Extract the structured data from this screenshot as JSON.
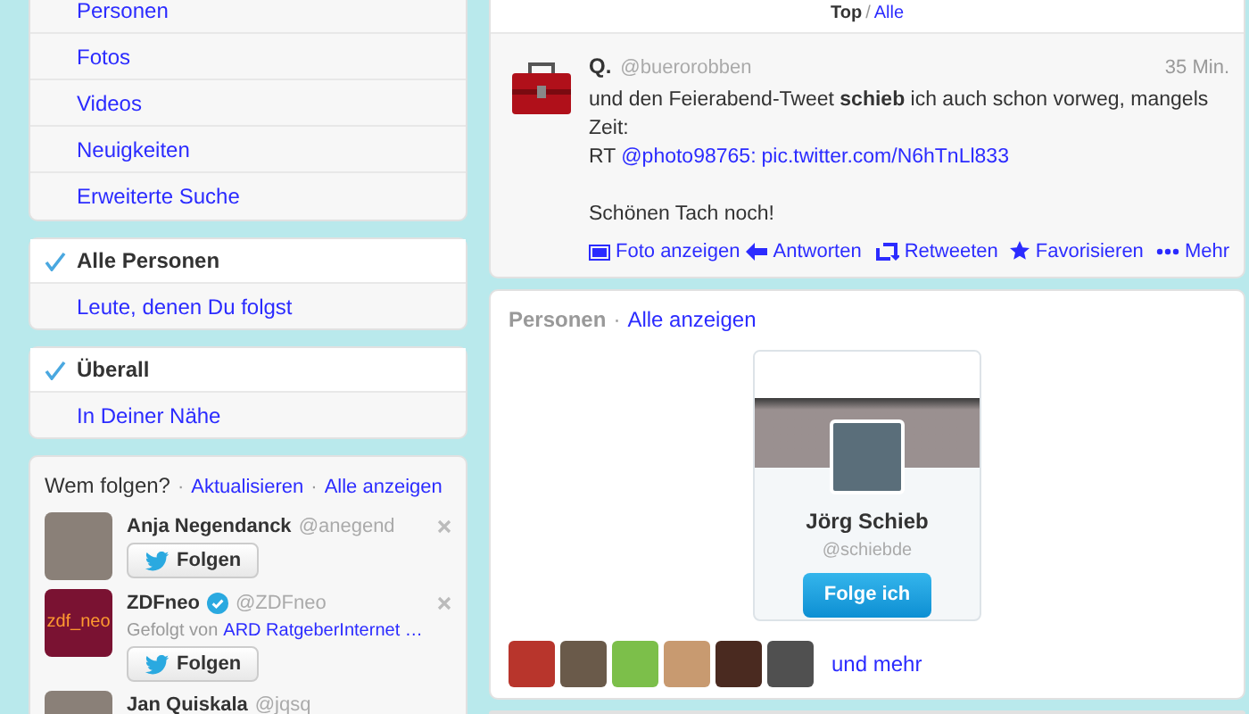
{
  "search_nav": {
    "items": [
      {
        "label": "Personen"
      },
      {
        "label": "Fotos"
      },
      {
        "label": "Videos"
      },
      {
        "label": "Neuigkeiten"
      },
      {
        "label": "Erweiterte Suche"
      }
    ]
  },
  "filters": [
    {
      "items": [
        {
          "label": "Alle Personen",
          "selected": true
        },
        {
          "label": "Leute, denen Du folgst",
          "selected": false
        }
      ]
    },
    {
      "items": [
        {
          "label": "Überall",
          "selected": true
        },
        {
          "label": "In Deiner Nähe",
          "selected": false
        }
      ]
    }
  ],
  "who_to_follow": {
    "title": "Wem folgen?",
    "separator": "·",
    "links": [
      "Aktualisieren",
      "Alle anzeigen"
    ],
    "people": [
      {
        "name": "Anja Negendanck",
        "handle": "@anegend",
        "verified": false,
        "button": "Folgen"
      },
      {
        "name": "ZDFneo",
        "handle": "@ZDFneo",
        "verified": true,
        "logo_text": "zdf_neo",
        "followed_by": "Gefolgt von",
        "followed_by_link": "ARD RatgeberInternet …",
        "button": "Folgen"
      },
      {
        "name": "Jan Quiskala",
        "handle": "@jqsq",
        "verified": false
      }
    ]
  },
  "timeline_switch": {
    "separator": "/",
    "items": [
      {
        "label": "Top",
        "selected": true
      },
      {
        "label": "Alle",
        "selected": false
      }
    ]
  },
  "tweet": {
    "name": "Q.",
    "handle": "@buerorobben",
    "time": "35 Min.",
    "text": "und den Feierabend-Tweet **schieb** ich auch schon vorweg, mangels Zeit:",
    "rt_prefix": "RT",
    "mention": "@photo98765",
    "mention_suffix": ":",
    "link": "pic.twitter.com/N6hTnLl833",
    "closing": "Schönen Tach noch!",
    "media_action": "Foto anzeigen",
    "actions": [
      {
        "kind": "reply",
        "label": "Antworten"
      },
      {
        "kind": "retweet",
        "label": "Retweeten"
      },
      {
        "kind": "favorite",
        "label": "Favorisieren"
      },
      {
        "kind": "more",
        "label": "Mehr"
      }
    ]
  },
  "people_module": {
    "title": "Personen",
    "separator": "·",
    "link": "Alle anzeigen",
    "card": {
      "name": "Jörg Schieb",
      "handle": "@schiebde",
      "button": "Folge ich"
    },
    "avatars": [
      {
        "color": "#b8352c"
      },
      {
        "color": "#6a5a4a"
      },
      {
        "color": "#7cbf4a"
      },
      {
        "color": "#c89a70"
      },
      {
        "color": "#4a2a20"
      },
      {
        "color": "#505050"
      }
    ],
    "more": "und mehr"
  }
}
